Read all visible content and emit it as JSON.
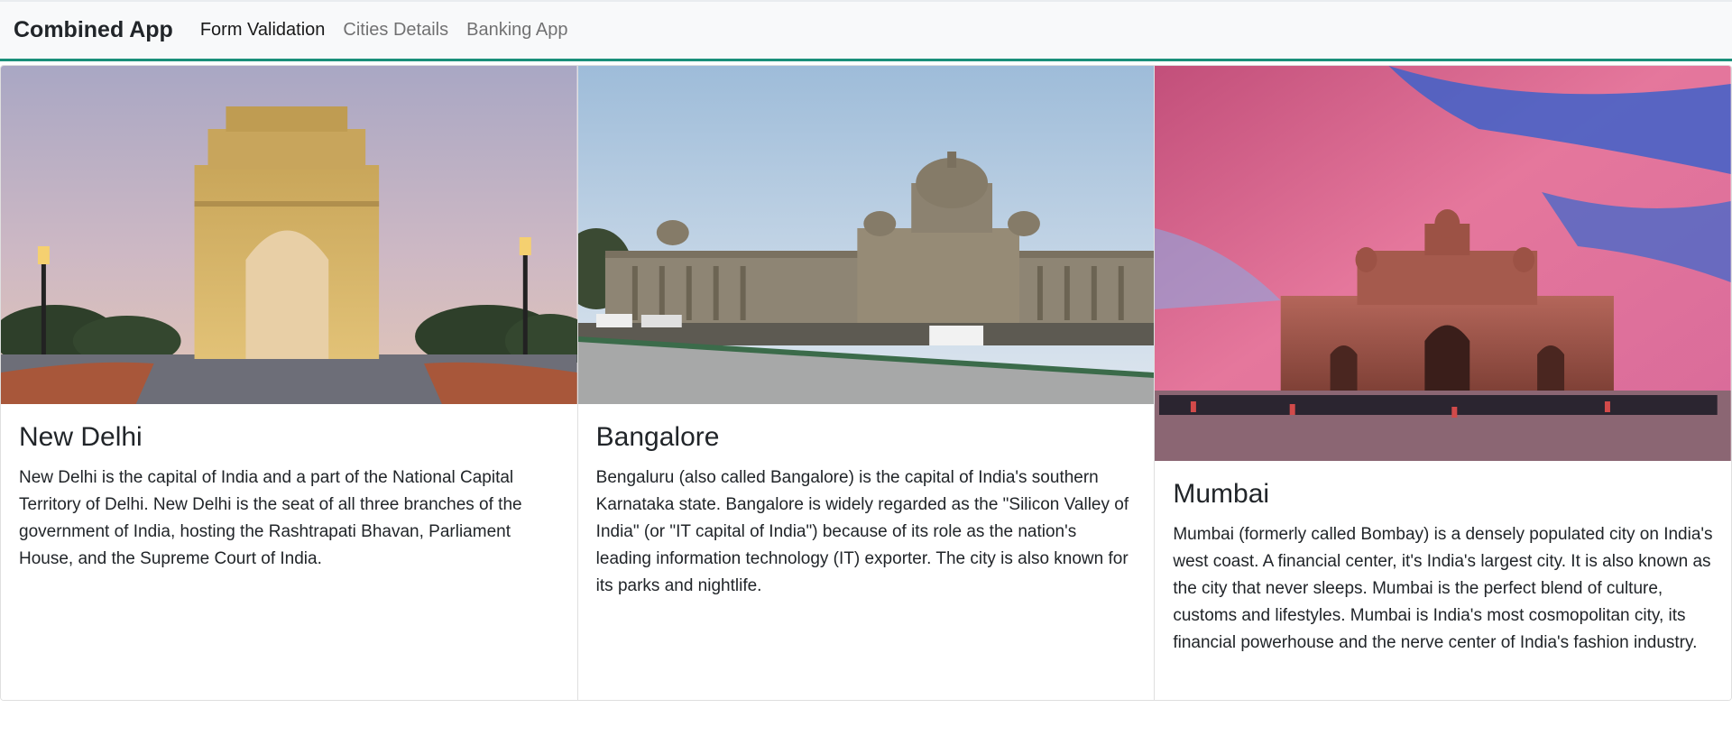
{
  "navbar": {
    "brand": "Combined App",
    "links": [
      {
        "label": "Form Validation",
        "active": true
      },
      {
        "label": "Cities Details",
        "active": false
      },
      {
        "label": "Banking App",
        "active": false
      }
    ],
    "accent_color": "#1a8f7a"
  },
  "cities": [
    {
      "name": "New Delhi",
      "image_icon": "india-gate-photo",
      "description": "New Delhi is the capital of India and a part of the National Capital Territory of Delhi. New Delhi is the seat of all three branches of the government of India, hosting the Rashtrapati Bhavan, Parliament House, and the Supreme Court of India."
    },
    {
      "name": "Bangalore",
      "image_icon": "vidhana-soudha-photo",
      "description": "Bengaluru (also called Bangalore) is the capital of India's southern Karnataka state. Bangalore is widely regarded as the \"Silicon Valley of India\" (or \"IT capital of India\") because of its role as the nation's leading information technology (IT) exporter. The city is also known for its parks and nightlife."
    },
    {
      "name": "Mumbai",
      "image_icon": "gateway-of-india-photo",
      "description": "Mumbai (formerly called Bombay) is a densely populated city on India's west coast. A financial center, it's India's largest city. It is also known as the city that never sleeps. Mumbai is the perfect blend of culture, customs and lifestyles. Mumbai is India's most cosmopolitan city, its financial powerhouse and the nerve center of India's fashion industry."
    }
  ]
}
